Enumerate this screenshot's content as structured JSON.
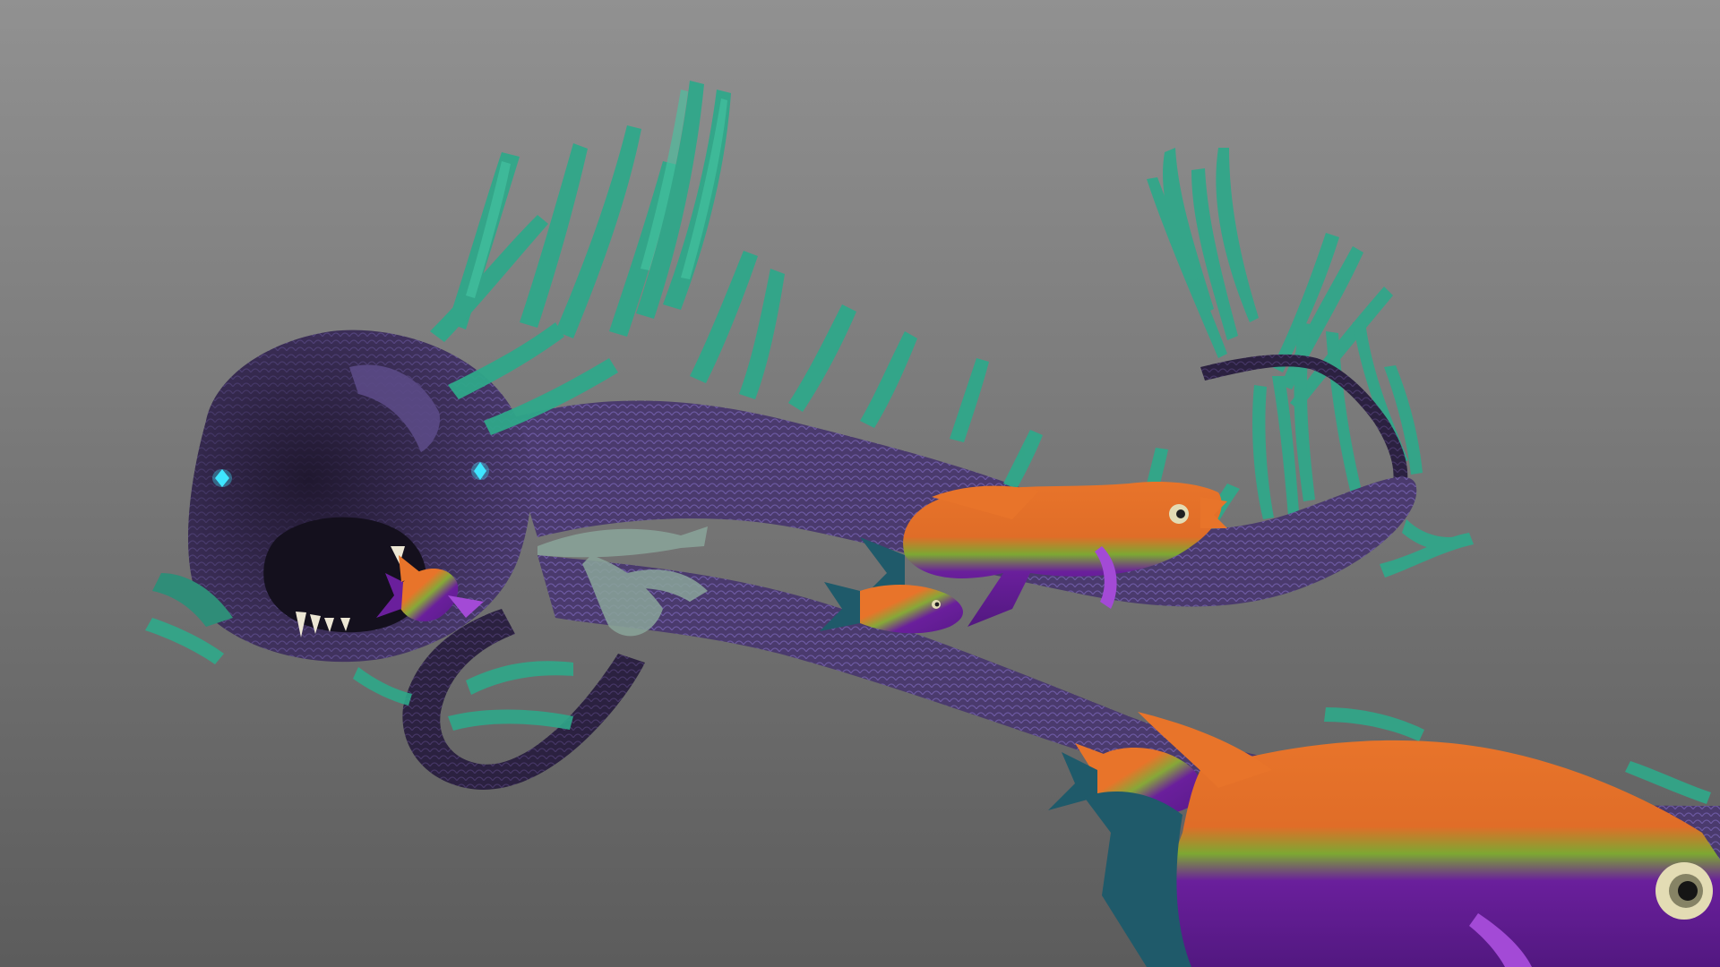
{
  "scene": {
    "subject": "",
    "colors": {
      "background_top": "#8f8f8f",
      "background_bottom": "#5e5e5e",
      "serpent_body": "#4b3a6e",
      "serpent_body_dark": "#2a1f3d",
      "serpent_scale_highlight": "#6f5aa0",
      "fins": "#2fa88a",
      "fins_light": "#46c7a3",
      "eye_glow": "#3fe6ff",
      "teeth": "#ece6d4",
      "fish_orange": "#e8742a",
      "fish_purple": "#6a1f9c",
      "fish_green": "#7ea832",
      "fish_fin_teal": "#1f5a6a",
      "fish_fin_violet": "#a34ad6",
      "fish_eye": "#e3dcb4",
      "ghost_fish": "#8aa59a"
    },
    "elements": {
      "sea_serpent": "sea-serpent",
      "fish_school": [
        "fish-large-foreground",
        "fish-medium-center",
        "fish-small-center",
        "fish-small-lower",
        "fish-tiny-near-mouth"
      ]
    }
  }
}
